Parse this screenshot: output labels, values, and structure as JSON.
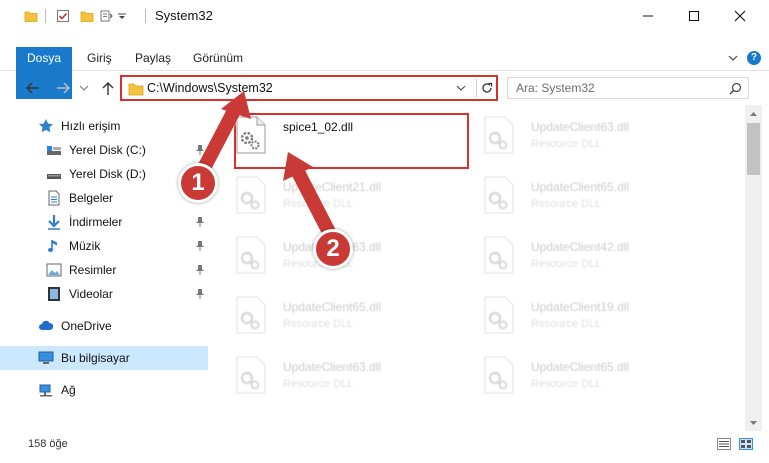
{
  "window": {
    "title": "System32",
    "minimize": "–",
    "maximize": "☐",
    "close": "✕"
  },
  "ribbon": {
    "tabs": [
      "Dosya",
      "Giriş",
      "Paylaş",
      "Görünüm"
    ]
  },
  "address": {
    "path": "C:\\Windows\\System32"
  },
  "search": {
    "placeholder": "Ara: System32"
  },
  "sidebar": {
    "items": [
      {
        "label": "Hızlı erişim",
        "icon": "star-icon"
      },
      {
        "label": "Yerel Disk (C:)",
        "icon": "drive-icon"
      },
      {
        "label": "Yerel Disk (D:)",
        "icon": "drive-icon"
      },
      {
        "label": "Belgeler",
        "icon": "documents-icon"
      },
      {
        "label": "İndirmeler",
        "icon": "download-icon"
      },
      {
        "label": "Müzik",
        "icon": "music-icon"
      },
      {
        "label": "Resimler",
        "icon": "pictures-icon"
      },
      {
        "label": "Videolar",
        "icon": "videos-icon"
      },
      {
        "label": "OneDrive",
        "icon": "cloud-icon"
      },
      {
        "label": "Bu bilgisayar",
        "icon": "computer-icon"
      },
      {
        "label": "Ağ",
        "icon": "network-icon"
      }
    ]
  },
  "files": [
    {
      "name": "spice1_02.dll",
      "type": ""
    },
    {
      "name": "UpdateClient63.dll",
      "type": "Resource DLL"
    },
    {
      "name": "UpdateClient21.dll",
      "type": "Resource DLL"
    },
    {
      "name": "UpdateClient65.dll",
      "type": "Resource DLL"
    },
    {
      "name": "UpdateClient63.dll",
      "type": "Resource DLL"
    },
    {
      "name": "UpdateClient42.dll",
      "type": "Resource DLL"
    },
    {
      "name": "UpdateClient65.dll",
      "type": "Resource DLL"
    },
    {
      "name": "UpdateClient19.dll",
      "type": "Resource DLL"
    },
    {
      "name": "UpdateClient63.dll",
      "type": "Resource DLL"
    },
    {
      "name": "UpdateClient65.dll",
      "type": "Resource DLL"
    }
  ],
  "status": {
    "count": "158 öğe"
  },
  "annotations": {
    "step1": "1",
    "step2": "2",
    "color": "#c93a36"
  }
}
